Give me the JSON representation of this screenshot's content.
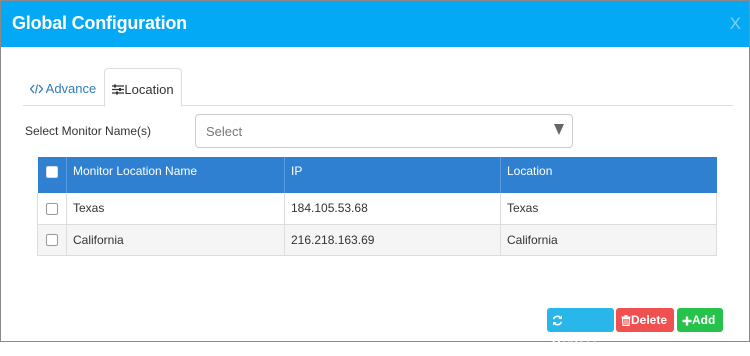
{
  "dialog": {
    "title": "Global Configuration",
    "close_label": "X"
  },
  "tabs": [
    {
      "label": "Advance",
      "icon": "code-icon",
      "active": false
    },
    {
      "label": "Location",
      "icon": "sliders-icon",
      "active": true
    }
  ],
  "monitor_select": {
    "label": "Select Monitor Name(s)",
    "value": "Select"
  },
  "table": {
    "columns": [
      "Monitor Location Name",
      "IP",
      "Location"
    ],
    "rows": [
      {
        "name": "Texas",
        "ip": "184.105.53.68",
        "location": "Texas"
      },
      {
        "name": "California",
        "ip": "216.218.163.69",
        "location": "California"
      }
    ]
  },
  "buttons": {
    "replace": "Replace",
    "delete": "Delete",
    "add": "Add"
  },
  "colors": {
    "titlebar": "#03a9f4",
    "table_header": "#2f80d1",
    "replace": "#29b6e8",
    "delete": "#f05050",
    "add": "#27c24c"
  }
}
